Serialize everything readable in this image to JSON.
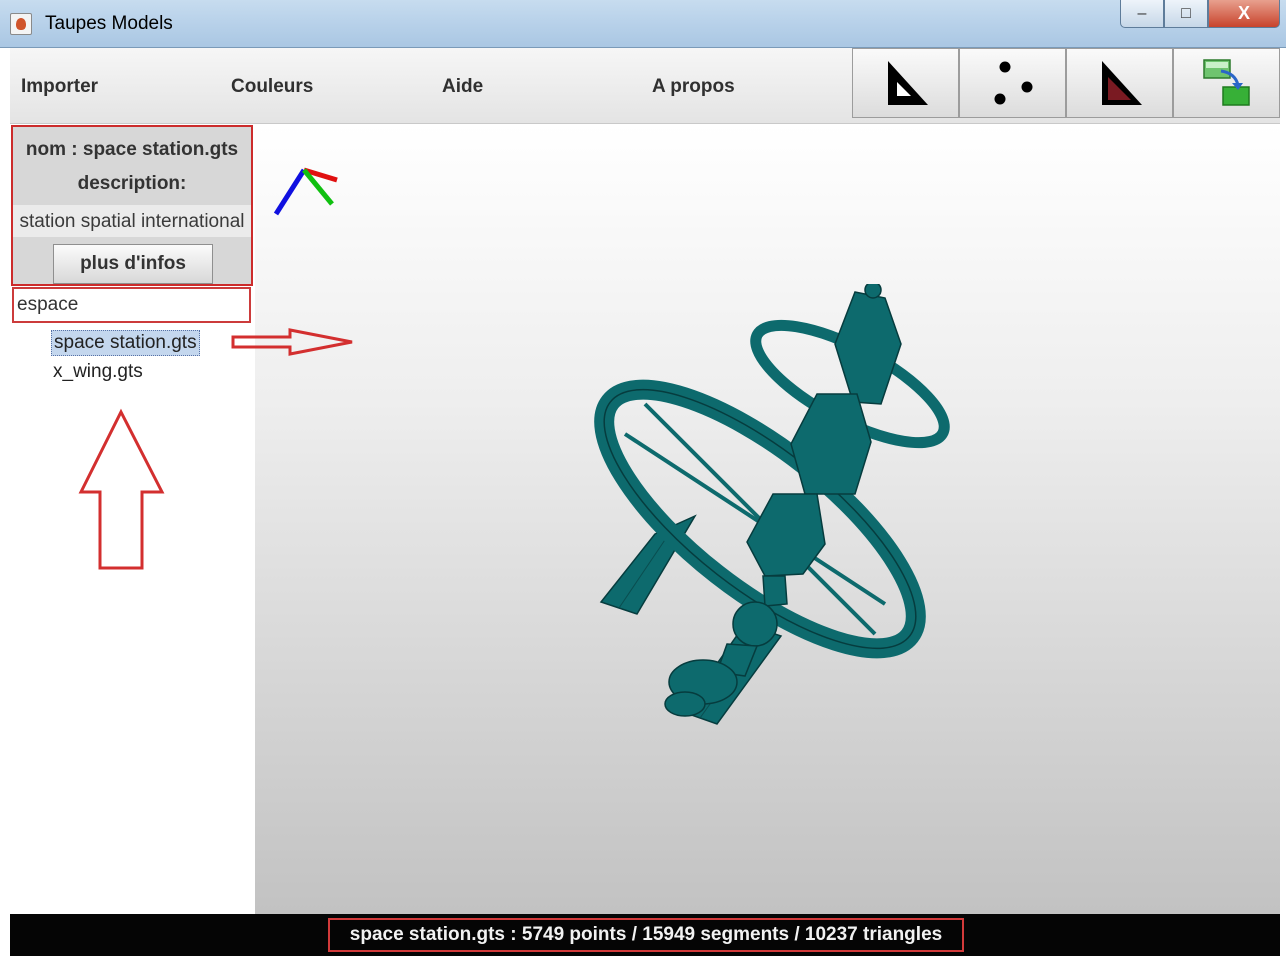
{
  "window": {
    "title": "Taupes Models",
    "controls": {
      "minimize": "–",
      "maximize": "□",
      "close": "X"
    }
  },
  "menu": {
    "items": [
      "Importer",
      "Couleurs",
      "Aide",
      "A propos"
    ]
  },
  "toolbar": {
    "buttons": [
      {
        "icon": "triangle-outline-icon"
      },
      {
        "icon": "points-icon"
      },
      {
        "icon": "triangle-filled-icon"
      },
      {
        "icon": "export-icon"
      }
    ]
  },
  "info": {
    "name": "nom : space station.gts",
    "description_label": "description:",
    "description": "station spatial international",
    "more_button": "plus d'infos"
  },
  "search": {
    "value": "espace"
  },
  "files": [
    {
      "name": "space station.gts",
      "selected": true
    },
    {
      "name": "x_wing.gts",
      "selected": false
    }
  ],
  "viewport": {
    "axes_colors": {
      "x": "#e01010",
      "y": "#10c010",
      "z": "#1010e0"
    },
    "model_color": "#0d6a6d"
  },
  "status": {
    "text": "space station.gts :   5749 points / 15949 segments / 10237 triangles"
  },
  "annotations": {
    "color": "#d32f2f"
  }
}
